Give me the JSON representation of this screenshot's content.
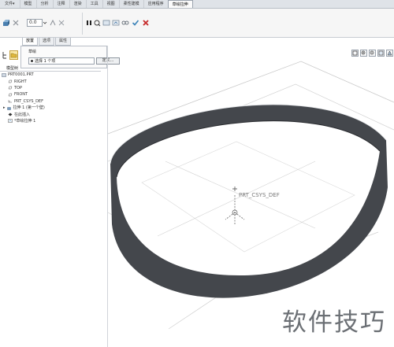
{
  "tabs": {
    "file": "文件▾",
    "items": [
      "模型",
      "分析",
      "注释",
      "渲染",
      "工具",
      "视图",
      "柔性建模",
      "应用程序",
      "草绘拉伸"
    ],
    "active_index": 8
  },
  "ribbon": {
    "dimension_value": "0.0"
  },
  "subtabs": [
    "放置",
    "选项",
    "属性"
  ],
  "references": {
    "title": "草绘",
    "selection_text": "选择 1 个项",
    "define_button": "定义..."
  },
  "model_tree": {
    "title": "模型树",
    "items": [
      {
        "label": "PRT0001.PRT",
        "icon": "part-icon"
      },
      {
        "label": "RIGHT",
        "icon": "datum-plane-icon"
      },
      {
        "label": "TOP",
        "icon": "datum-plane-icon"
      },
      {
        "label": "FRONT",
        "icon": "datum-plane-icon"
      },
      {
        "label": "PRT_CSYS_DEF",
        "icon": "csys-icon"
      },
      {
        "label": "拉伸 1 (第一个壁)",
        "icon": "extrude-icon"
      },
      {
        "label": "在此插入",
        "icon": "insert-here-icon"
      },
      {
        "label": "*草绘拉伸 1",
        "icon": "sketch-extrude-icon"
      }
    ]
  },
  "viewport": {
    "csys_label": "PRT_CSYS_DEF"
  },
  "watermark": "软件技巧"
}
